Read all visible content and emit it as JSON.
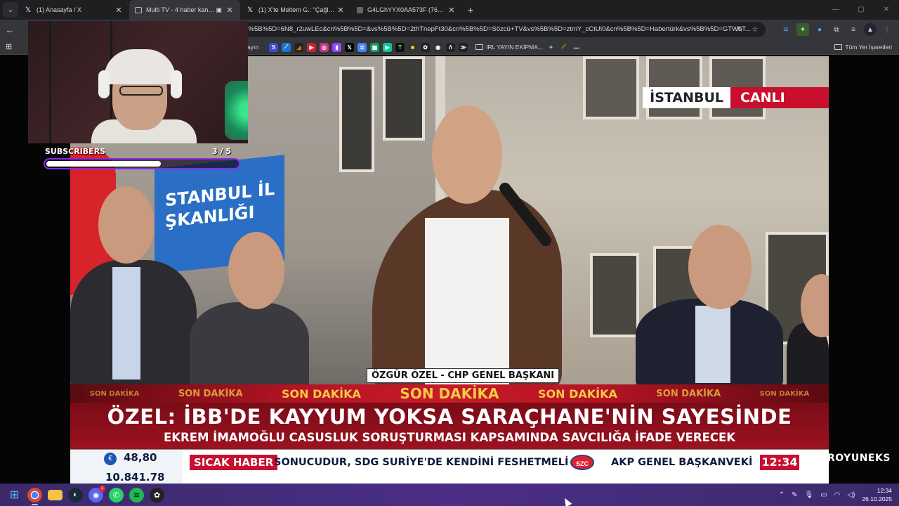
{
  "browser": {
    "tabs": [
      {
        "label": "(1) Anasayfa / X",
        "icon": "x-icon",
        "active": false
      },
      {
        "label": "Multi TV - 4 haber kanalını",
        "icon": "tv-icon",
        "active": true
      },
      {
        "label": "(1) X'te Meltem G.: \"Çağlayan",
        "icon": "x-icon",
        "active": false
      },
      {
        "label": "G4LGhYYX0AA573F (768×1024)",
        "icon": "image-icon",
        "active": false
      }
    ],
    "new_tab": "+",
    "url": "vs%5B%5D=6N8_r2uwLEc&cn%5B%5D=&vs%5B%5D=2thTnepFt30&cn%5B%5D=Sözcü+TV&vs%5B%5D=ztmY_cCtUI0&cn%5B%5D=Habertürk&vs%5B%5D=GTWbT...",
    "bookmark_partial": "ayın",
    "bookmark_folder": "IRL YAYIN EKİPMA...",
    "all_bookmarks": "Tüm Yer İşaretleri"
  },
  "stream_overlay": {
    "subscribers_label": "SUBSCRIBERS",
    "subscribers_count": "3  / 5",
    "subscribers_progress": 0.6
  },
  "broadcast": {
    "city": "İSTANBUL",
    "live_label": "CANLI",
    "banner_text": "STANBUL İL\nŞKANLIĞI",
    "name_tag": "ÖZGÜR ÖZEL - CHP GENEL BAŞKANI",
    "breaking_labels": [
      "SON DAKİKA",
      "SON DAKİKA",
      "SON DAKİKA",
      "SON DAKİKA",
      "SON DAKİKA",
      "SON DAKİKA",
      "SON DAKİKA"
    ],
    "headline": "ÖZEL: İBB'DE KAYYUM YOKSA SARAÇHANE'NİN SAYESİNDE",
    "subheadline": "EKREM İMAMOĞLU CASUSLUK SORUŞTURMASI KAPSAMINDA SAVCILIĞA İFADE VERECEK",
    "market_value_1": "48,80",
    "market_value_2": "10.841,78",
    "hot_news_label": "SICAK HABER",
    "ticker_text": "SONUCUDUR, SDG SURİYE'DE KENDİNİ FESHETMELİ",
    "ticker_logo": "SZC",
    "ticker_text_2": "AKP GENEL BAŞKANVEKİLİ",
    "ticker_time": "12:34",
    "watermark": "ROYUNEKS"
  },
  "taskbar": {
    "time": "12:34",
    "date": "26.10.2025",
    "discord_badge": "1"
  },
  "colors": {
    "accent_red": "#c8102e",
    "breaking_yellow": "#f7c945",
    "taskbar_purple": "#4b2e86"
  }
}
